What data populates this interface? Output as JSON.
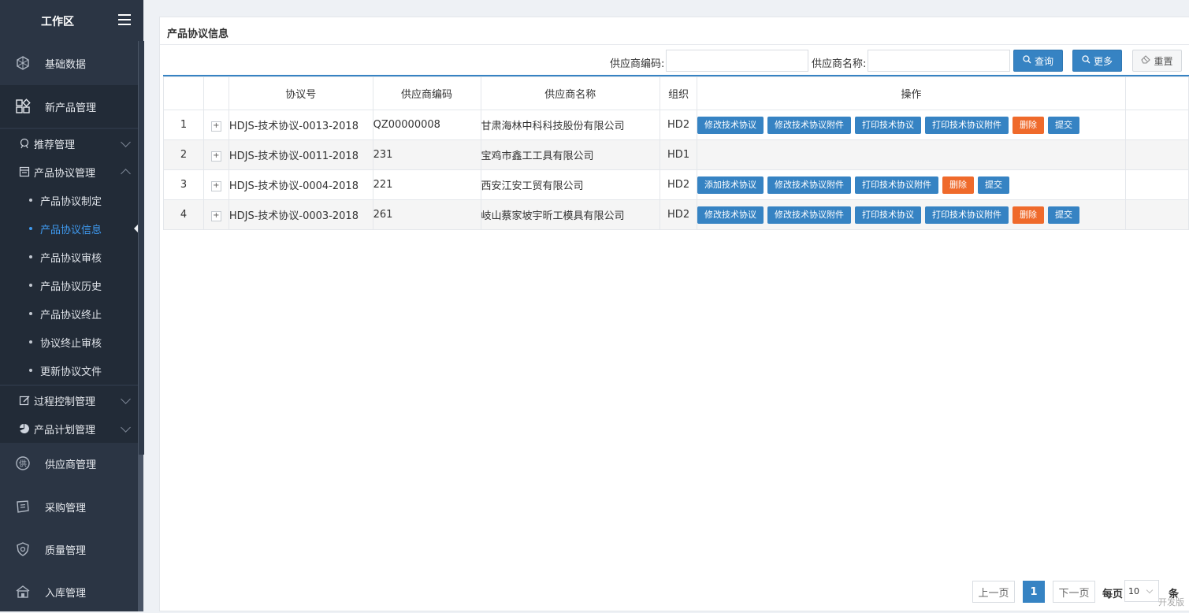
{
  "sidebar": {
    "title": "工作区",
    "menu_icon": "hamburger-icon",
    "modules": [
      {
        "label": "基础数据",
        "icon": "cube-network-icon"
      },
      {
        "label": "新产品管理",
        "icon": "grid-apps-icon"
      },
      {
        "label": "供应商管理",
        "icon": "supplier-icon"
      },
      {
        "label": "采购管理",
        "icon": "ticket-icon"
      },
      {
        "label": "质量管理",
        "icon": "shield-icon"
      },
      {
        "label": "入库管理",
        "icon": "warehouse-icon"
      }
    ],
    "groups": [
      {
        "label": "推荐管理",
        "icon": "recommend-icon"
      },
      {
        "label": "产品协议管理",
        "icon": "contract-icon"
      },
      {
        "label": "过程控制管理",
        "icon": "edit-icon"
      },
      {
        "label": "产品计划管理",
        "icon": "pie-chart-icon"
      }
    ],
    "subitems": [
      {
        "label": "产品协议制定"
      },
      {
        "label": "产品协议信息"
      },
      {
        "label": "产品协议审核"
      },
      {
        "label": "产品协议历史"
      },
      {
        "label": "产品协议终止"
      },
      {
        "label": "协议终止审核"
      },
      {
        "label": "更新协议文件"
      }
    ]
  },
  "panel": {
    "title": "产品协议信息"
  },
  "search": {
    "supplier_code_label": "供应商编码:",
    "supplier_code_value": "",
    "supplier_name_label": "供应商名称:",
    "supplier_name_value": "",
    "query_label": "查询",
    "more_label": "更多",
    "reset_label": "重置"
  },
  "table": {
    "columns": [
      "协议号",
      "供应商编码",
      "供应商名称",
      "组织",
      "操作"
    ],
    "rows": [
      {
        "index": "1",
        "expand": "+",
        "agreement": "HDJS-技术协议-0013-2018",
        "code": "QZ00000008",
        "name": "甘肃海林中科科技股份有限公司",
        "org": "HD2",
        "actions": [
          "修改技术协议",
          "修改技术协议附件",
          "打印技术协议",
          "打印技术协议附件",
          "删除",
          "提交"
        ]
      },
      {
        "index": "2",
        "expand": "+",
        "agreement": "HDJS-技术协议-0011-2018",
        "code": "231",
        "name": "宝鸡市鑫工工具有限公司",
        "org": "HD1",
        "actions": []
      },
      {
        "index": "3",
        "expand": "+",
        "agreement": "HDJS-技术协议-0004-2018",
        "code": "221",
        "name": "西安江安工贸有限公司",
        "org": "HD2",
        "actions": [
          "添加技术协议",
          "修改技术协议附件",
          "打印技术协议附件",
          "删除",
          "提交"
        ]
      },
      {
        "index": "4",
        "expand": "+",
        "agreement": "HDJS-技术协议-0003-2018",
        "code": "261",
        "name": "岐山蔡家坡宇昕工模具有限公司",
        "org": "HD2",
        "actions": [
          "修改技术协议",
          "修改技术协议附件",
          "打印技术协议",
          "打印技术协议附件",
          "删除",
          "提交"
        ]
      }
    ]
  },
  "pagination": {
    "prev": "上一页",
    "current": "1",
    "next": "下一页",
    "per_page_label": "每页",
    "per_page_value": "10",
    "unit": "条"
  },
  "edition": "开发版",
  "colors": {
    "sidebar_bg": "#2b3544",
    "primary": "#3683c3",
    "danger": "#ef6a2b",
    "active_link": "#3f9af0"
  }
}
